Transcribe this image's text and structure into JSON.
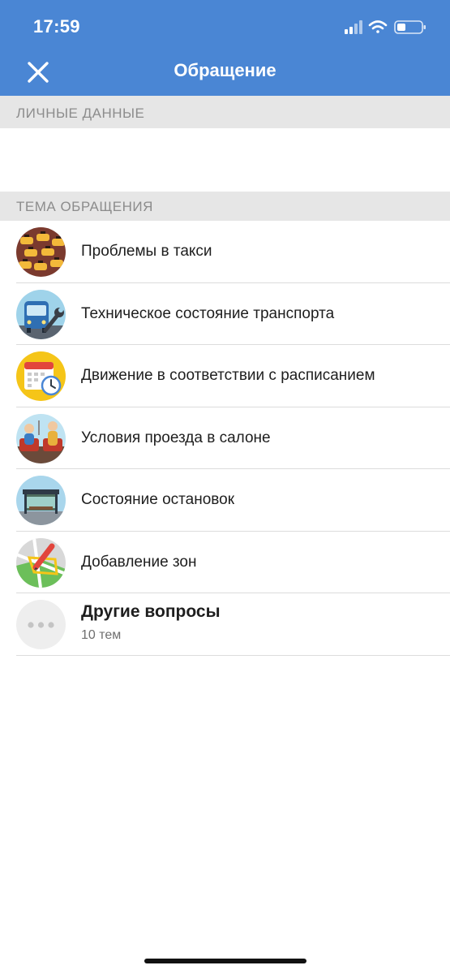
{
  "status_bar": {
    "time": "17:59"
  },
  "header": {
    "title": "Обращение",
    "close_icon": "close-icon",
    "background": "#4a86d4"
  },
  "sections": {
    "personal": "ЛИЧНЫЕ ДАННЫЕ",
    "topic": "ТЕМА ОБРАЩЕНИЯ"
  },
  "topics": [
    {
      "label": "Проблемы в такси",
      "icon": "taxi-icon"
    },
    {
      "label": "Техническое состояние транспорта",
      "icon": "bus-repair-icon"
    },
    {
      "label": "Движение в соответствии с расписанием",
      "icon": "calendar-clock-icon"
    },
    {
      "label": "Условия проезда в салоне",
      "icon": "passengers-icon"
    },
    {
      "label": "Состояние остановок",
      "icon": "bus-stop-icon"
    },
    {
      "label": "Добавление зон",
      "icon": "map-pencil-icon"
    }
  ],
  "other": {
    "label": "Другие вопросы",
    "sub": "10 тем",
    "icon": "more-icon"
  }
}
